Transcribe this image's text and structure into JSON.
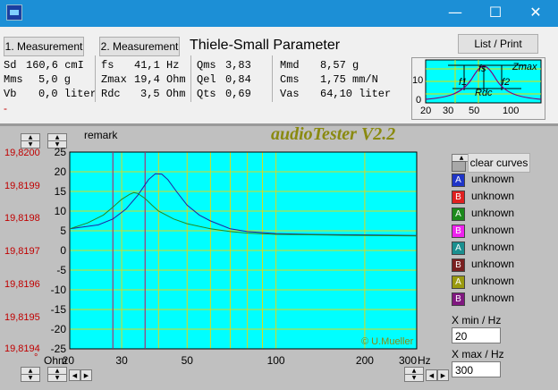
{
  "titlebar": {
    "minimize": "—",
    "maximize": "☐",
    "close": "✕"
  },
  "buttons": {
    "measurement1": "1. Measurement",
    "measurement2": "2. Measurement",
    "list_print": "List / Print"
  },
  "heading": "Thiele-Small Parameter",
  "params": {
    "sd": {
      "label": "Sd",
      "value": "160,6 cmI"
    },
    "mms": {
      "label": "Mms",
      "value": "5,0 g"
    },
    "vb": {
      "label": "Vb",
      "value": "0,0 liter"
    },
    "fs": {
      "label": "fs",
      "value": "41,1 Hz"
    },
    "zmax": {
      "label": "Zmax",
      "value": "19,4 Ohm"
    },
    "rdc": {
      "label": "Rdc",
      "value": "3,5 Ohm"
    },
    "qms": {
      "label": "Qms",
      "value": "3,83"
    },
    "qel": {
      "label": "Qel",
      "value": "0,84"
    },
    "qts": {
      "label": "Qts",
      "value": "0,69"
    },
    "mmd": {
      "label": "Mmd",
      "value": "8,57 g"
    },
    "cms": {
      "label": "Cms",
      "value": "1,75 mm/N"
    },
    "vas": {
      "label": "Vas",
      "value": "64,10 liter"
    }
  },
  "minus_marker": "-",
  "thumbnail": {
    "labels": {
      "zmax": "Zmax",
      "f1": "f1",
      "fs": "fs",
      "f2": "f2",
      "rdc": "Rdc"
    },
    "y_ticks": [
      "10",
      "0"
    ],
    "x_ticks": [
      "20",
      "30",
      "50",
      "100"
    ]
  },
  "remark_label": "remark",
  "app_title": "audioTester V2.2",
  "copyright": "© U.Mueller",
  "left_axis_values": [
    "19,8200",
    "19,8199",
    "19,8198",
    "19,8197",
    "19,8196",
    "19,8195",
    "19,8194"
  ],
  "left_axis_marker": "°",
  "y_unit": "Ohm",
  "x_unit": "Hz",
  "x_ticks": [
    "20",
    "30",
    "50",
    "100",
    "200",
    "300"
  ],
  "clear_curves": "clear curves",
  "curves": [
    {
      "letter": "A",
      "name": "unknown",
      "color": "#1f35c8"
    },
    {
      "letter": "B",
      "name": "unknown",
      "color": "#e02020"
    },
    {
      "letter": "A",
      "name": "unknown",
      "color": "#1c8a1c"
    },
    {
      "letter": "B",
      "name": "unknown",
      "color": "#ee22ee"
    },
    {
      "letter": "A",
      "name": "unknown",
      "color": "#1a8f8f"
    },
    {
      "letter": "B",
      "name": "unknown",
      "color": "#7a2020"
    },
    {
      "letter": "A",
      "name": "unknown",
      "color": "#9a9a10"
    },
    {
      "letter": "B",
      "name": "unknown",
      "color": "#801880"
    }
  ],
  "xmin": {
    "label": "X min / Hz",
    "value": "20"
  },
  "xmax": {
    "label": "X max / Hz",
    "value": "300"
  },
  "chart_data": {
    "type": "line",
    "xlabel": "Hz",
    "ylabel": "Ohm",
    "xscale": "log",
    "xlim": [
      20,
      300
    ],
    "ylim": [
      -25,
      25
    ],
    "x_ticks": [
      20,
      30,
      50,
      100,
      200,
      300
    ],
    "y_ticks": [
      25,
      20,
      15,
      10,
      5,
      0,
      -5,
      -10,
      -15,
      -20,
      -25
    ],
    "grid": true,
    "markers_hz": [
      28,
      36
    ],
    "series": [
      {
        "color": "#2020a0",
        "x": [
          20,
          25,
          28,
          31,
          34,
          37,
          39,
          41,
          43,
          46,
          50,
          55,
          60,
          70,
          80,
          100,
          130,
          170,
          220,
          300
        ],
        "y": [
          5.5,
          6.5,
          8,
          10.5,
          14,
          18,
          19.5,
          19.4,
          18,
          15,
          11.5,
          9,
          7.5,
          5.5,
          4.8,
          4.3,
          4.1,
          4.0,
          3.9,
          3.8
        ]
      },
      {
        "color": "#208a20",
        "x": [
          20,
          23,
          26,
          28,
          30,
          32,
          33,
          34,
          36,
          38,
          40,
          45,
          50,
          60,
          70,
          80,
          100,
          150,
          200,
          300
        ],
        "y": [
          5.5,
          7,
          9,
          11,
          13,
          14.3,
          14.7,
          14.5,
          13.2,
          11.5,
          10,
          8,
          6.8,
          5.5,
          4.8,
          4.4,
          4.1,
          3.9,
          3.8,
          3.7
        ]
      }
    ]
  }
}
